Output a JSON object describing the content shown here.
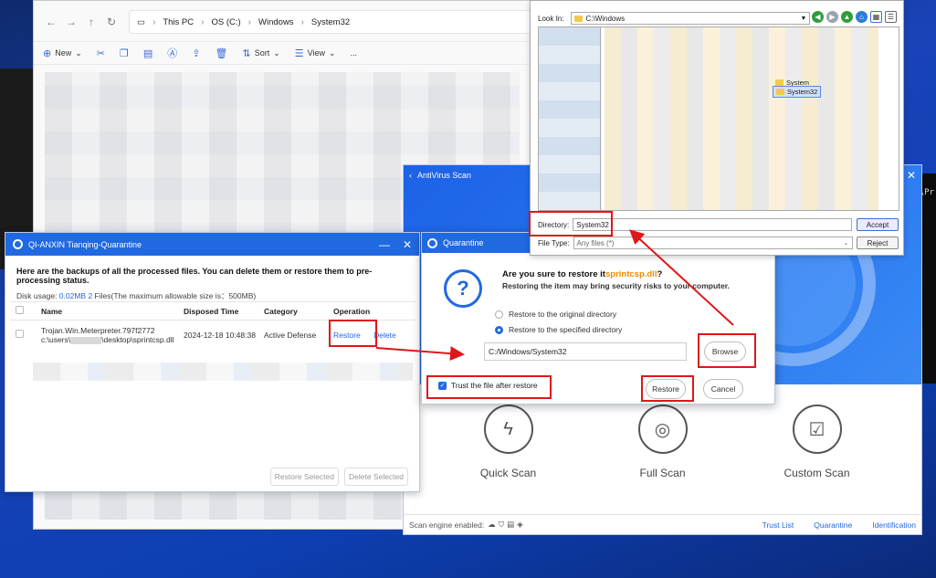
{
  "explorer": {
    "breadcrumb": [
      "This PC",
      "OS (C:)",
      "Windows",
      "System32"
    ],
    "toolbar": {
      "new": "New",
      "sort": "Sort",
      "view": "View",
      "more": "..."
    }
  },
  "desktop": {
    "terminal_fragment": "\\Pr"
  },
  "quarantine_list": {
    "title": "QI-ANXIN Tianqing-Quarantine",
    "heading": "Here are the backups of all the processed files. You can delete them or restore them to pre-processing status.",
    "usage_prefix": "Disk usage: ",
    "usage_size": "0.02MB",
    "usage_count": "2",
    "usage_suffix": " Files(The maximum allowable size is：500MB)",
    "columns": [
      "Name",
      "Disposed Time",
      "Category",
      "Operation"
    ],
    "row": {
      "name_line1": "Trojan.Win.Meterpreter.797f2772",
      "name_line2_start": "c:\\users\\",
      "name_line2_end": "\\desktop\\sprintcsp.dll",
      "time": "2024-12-18 10:48:38",
      "category": "Active Defense",
      "restore": "Restore",
      "delete": "Delete"
    },
    "restore_selected": "Restore Selected",
    "delete_selected": "Delete Selected"
  },
  "antivirus": {
    "title": "AntiVirus Scan",
    "scans": [
      "Quick Scan",
      "Full Scan",
      "Custom Scan"
    ],
    "engine_label": "Scan engine enabled:",
    "links": [
      "Trust List",
      "Quarantine",
      "Identification"
    ]
  },
  "restore_dialog": {
    "title": "Quarantine",
    "question_prefix": "Are you sure to restore it",
    "filename": "sprintcsp.dll",
    "question_suffix": "?",
    "warning": "Restoring the item may bring security risks to your computer.",
    "option_original": "Restore to the original directory",
    "option_specified": "Restore to the specified directory",
    "path": "C:/Windows/System32",
    "browse": "Browse",
    "trust": "Trust the file after restore",
    "restore": "Restore",
    "cancel": "Cancel"
  },
  "file_chooser": {
    "look_in_label": "Look In:",
    "look_in_value": "C:\\Windows",
    "folders": [
      "System",
      "System32"
    ],
    "directory_label": "Directory:",
    "directory_value": "System32",
    "filetype_label": "File Type:",
    "filetype_value": "Any files (*)",
    "accept": "Accept",
    "reject": "Reject"
  },
  "colors": {
    "accent": "#2169e0",
    "highlight_red": "#e0161a",
    "filename_orange": "#f08a00"
  }
}
